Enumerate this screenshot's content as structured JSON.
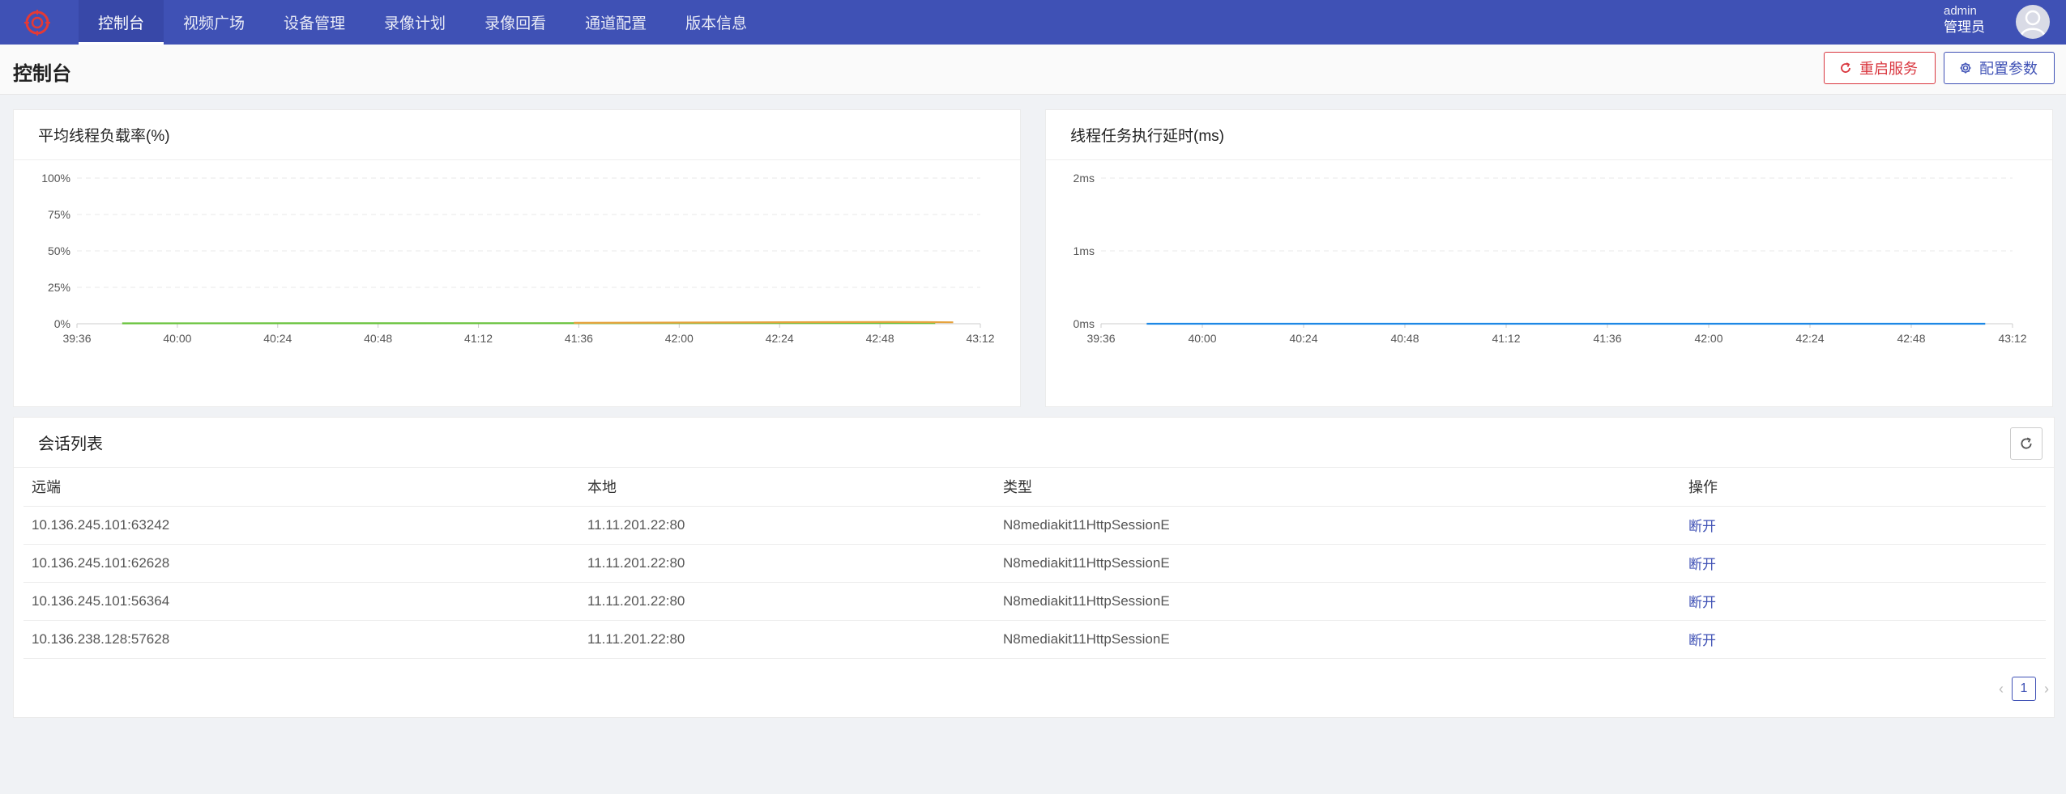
{
  "nav": {
    "items": [
      {
        "label": "控制台",
        "active": true
      },
      {
        "label": "视频广场"
      },
      {
        "label": "设备管理"
      },
      {
        "label": "录像计划"
      },
      {
        "label": "录像回看"
      },
      {
        "label": "通道配置"
      },
      {
        "label": "版本信息"
      }
    ],
    "user": {
      "name": "admin",
      "role": "管理员"
    },
    "accent": "#3f51b5"
  },
  "header": {
    "title": "控制台",
    "restart_label": "重启服务",
    "config_label": "配置参数"
  },
  "chart_data": [
    {
      "type": "line",
      "title": "平均线程负载率(%)",
      "x": [
        "39:36",
        "40:00",
        "40:24",
        "40:48",
        "41:12",
        "41:36",
        "42:00",
        "42:24",
        "42:48",
        "43:12"
      ],
      "yticks": [
        "0%",
        "25%",
        "50%",
        "75%",
        "100%"
      ],
      "ylim": [
        0,
        100
      ],
      "series": [
        {
          "color": "#67c23a",
          "points": [
            [
              0.05,
              0.3
            ],
            [
              0.5,
              0.4
            ],
            [
              0.95,
              0.5
            ]
          ]
        },
        {
          "color": "#e6a23c",
          "points": [
            [
              0.55,
              0.6
            ],
            [
              0.9,
              1.2
            ],
            [
              0.97,
              1.0
            ]
          ]
        }
      ]
    },
    {
      "type": "line",
      "title": "线程任务执行延时(ms)",
      "x": [
        "39:36",
        "40:00",
        "40:24",
        "40:48",
        "41:12",
        "41:36",
        "42:00",
        "42:24",
        "42:48",
        "43:12"
      ],
      "yticks": [
        "0ms",
        "1ms",
        "2ms"
      ],
      "ylim": [
        0,
        2
      ],
      "series": [
        {
          "color": "#1e88e5",
          "points": [
            [
              0.05,
              0.0
            ],
            [
              0.5,
              0.0
            ],
            [
              0.97,
              0.0
            ]
          ]
        }
      ]
    }
  ],
  "sessions": {
    "title": "会话列表",
    "columns": [
      "远端",
      "本地",
      "类型",
      "操作"
    ],
    "rows": [
      [
        "10.136.245.101:63242",
        "11.11.201.22:80",
        "N8mediakit11HttpSessionE",
        "断开"
      ],
      [
        "10.136.245.101:62628",
        "11.11.201.22:80",
        "N8mediakit11HttpSessionE",
        "断开"
      ],
      [
        "10.136.245.101:56364",
        "11.11.201.22:80",
        "N8mediakit11HttpSessionE",
        "断开"
      ],
      [
        "10.136.238.128:57628",
        "11.11.201.22:80",
        "N8mediakit11HttpSessionE",
        "断开"
      ]
    ],
    "page": "1"
  }
}
